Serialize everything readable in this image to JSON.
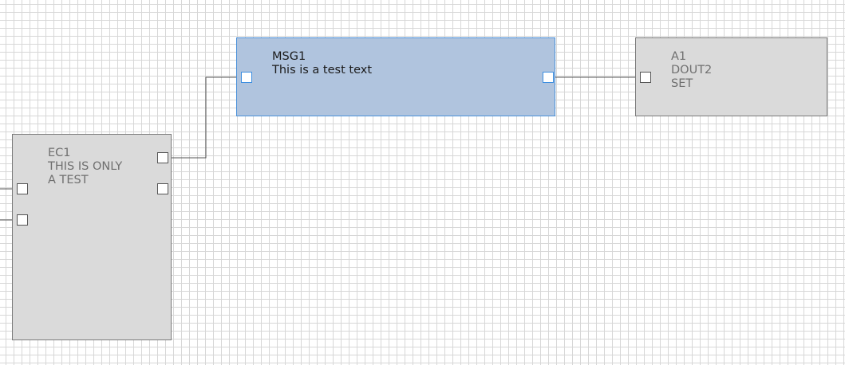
{
  "blocks": {
    "msg1": {
      "name": "MSG1",
      "line1": "This is a test text",
      "selected": true
    },
    "a1": {
      "name": "A1",
      "line1": "DOUT2",
      "line2": "SET"
    },
    "ec1": {
      "name": "EC1",
      "line1": "THIS IS ONLY",
      "line2": "A TEST"
    }
  },
  "colors": {
    "block_fill": "#dadada",
    "selected_fill": "#b0c4de",
    "selected_border": "#4a90d9",
    "grid": "#d7d7d7"
  }
}
